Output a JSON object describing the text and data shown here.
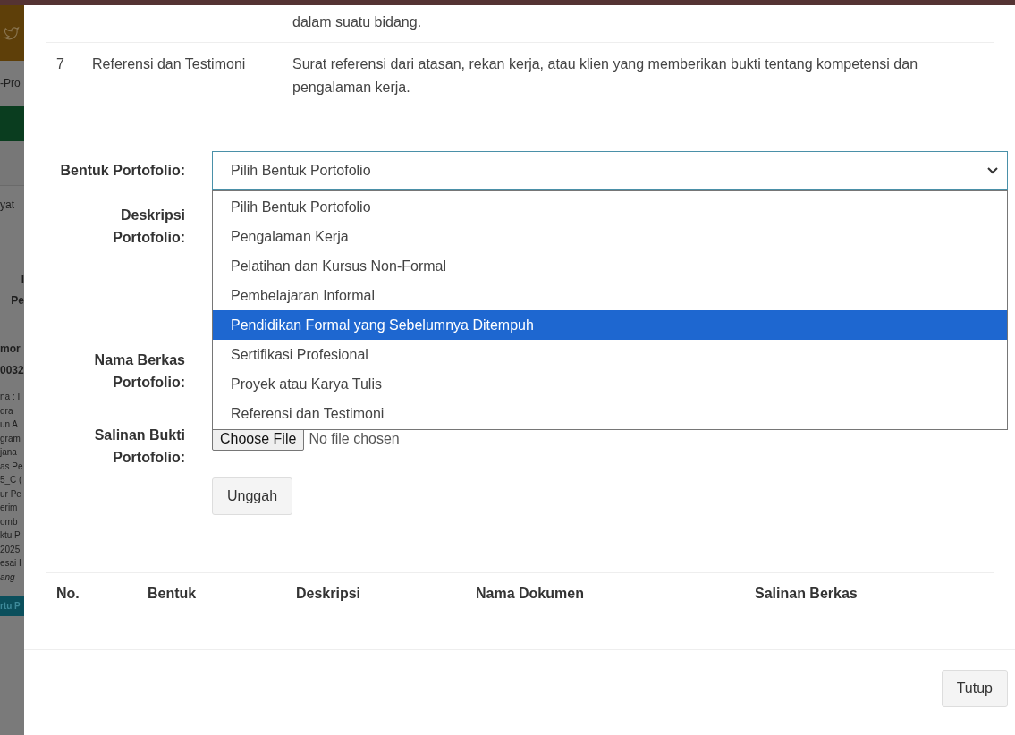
{
  "background_page": {
    "top_text": "-Pro",
    "menu_text": "yat",
    "heading_lines": [
      "I",
      "Pe"
    ],
    "number_lines": [
      "mor",
      "0032"
    ],
    "detail_lines": [
      "na : I",
      "dra",
      "un A",
      "gram",
      "jana",
      "as Pe",
      "5_C (",
      "ur Pe",
      "erim",
      "omb",
      "ktu P",
      "2025",
      "esai I"
    ],
    "italic_line": "ang",
    "button": "rtu P"
  },
  "reference_table": {
    "rows": [
      {
        "number": "",
        "form": "",
        "description": "dalam suatu bidang."
      },
      {
        "number": "7",
        "form": "Referensi dan Testimoni",
        "description": "Surat referensi dari atasan, rekan kerja, atau klien yang memberikan bukti tentang kompetensi dan pengalaman kerja."
      }
    ]
  },
  "form": {
    "form_label": "Bentuk Portofolio:",
    "form_select": {
      "value": "Pilih Bentuk Portofolio",
      "expanded": true,
      "options": [
        {
          "label": "Pilih Bentuk Portofolio",
          "highlighted": false
        },
        {
          "label": "Pengalaman Kerja",
          "highlighted": false
        },
        {
          "label": "Pelatihan dan Kursus Non-Formal",
          "highlighted": false
        },
        {
          "label": "Pembelajaran Informal",
          "highlighted": false
        },
        {
          "label": "Pendidikan Formal yang Sebelumnya Ditempuh",
          "highlighted": true
        },
        {
          "label": "Sertifikasi Profesional",
          "highlighted": false
        },
        {
          "label": "Proyek atau Karya Tulis",
          "highlighted": false
        },
        {
          "label": "Referensi dan Testimoni",
          "highlighted": false
        }
      ]
    },
    "description_label": "Deskripsi Portofolio:",
    "file_name_label": "Nama Berkas Portofolio:",
    "copy_label": "Salinan Bukti Portofolio:",
    "file_button": "Choose File",
    "file_status": "No file chosen",
    "upload_button": "Unggah"
  },
  "portfolio_table": {
    "columns": [
      "No.",
      "Bentuk",
      "Deskripsi",
      "Nama Dokumen",
      "Salinan Berkas"
    ]
  },
  "footer": {
    "close_button": "Tutup"
  }
}
